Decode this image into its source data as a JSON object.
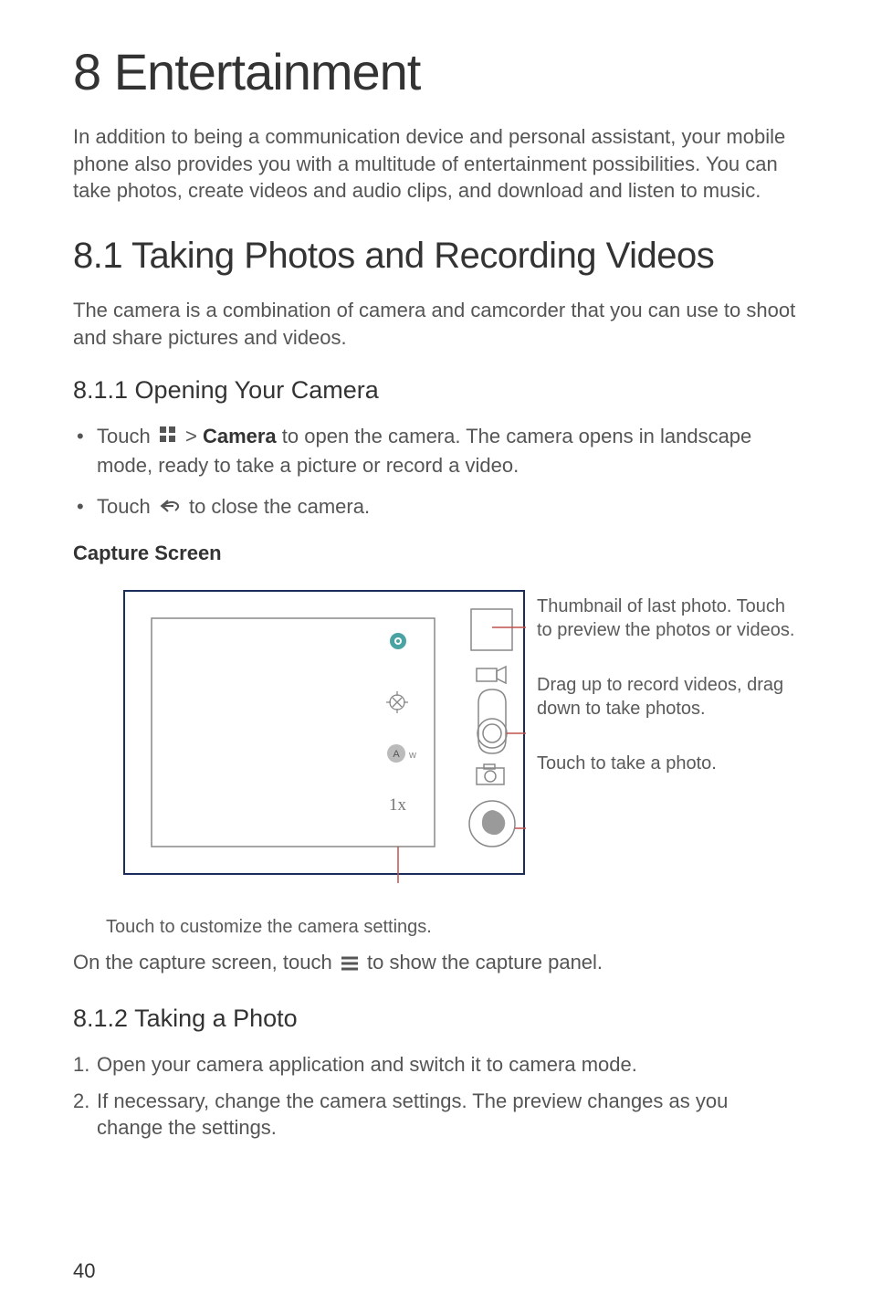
{
  "h1": "8  Entertainment",
  "intro": "In addition to being a communication device and personal assistant, your mobile phone also provides you with a multitude of entertainment possibilities. You can take photos, create videos and audio clips, and download and listen to music.",
  "h2": "8.1  Taking Photos and Recording Videos",
  "p2": "The camera is a combination of camera and camcorder that you can use to shoot and share pictures and videos.",
  "h3_1": "8.1.1  Opening Your Camera",
  "bullets": {
    "b1_a": "Touch",
    "b1_b": ">",
    "b1_bold": "Camera",
    "b1_c": "to open the camera. The camera opens in landscape mode, ready to take a picture or record a video.",
    "b2_a": "Touch",
    "b2_b": "to close the camera."
  },
  "subhead": "Capture Screen",
  "callouts": {
    "c1": "Thumbnail of last photo. Touch to preview the photos or videos.",
    "c2": "Drag up to record videos, drag down to take photos.",
    "c3": "Touch to take a photo."
  },
  "settings_caption": "Touch to customize the camera settings.",
  "body_line_a": "On the capture screen, touch",
  "body_line_b": "to show the capture panel.",
  "h3_2": "8.1.2  Taking a Photo",
  "ol": {
    "i1": "Open your camera application and switch it to camera mode.",
    "i2": "If necessary, change the camera settings. The preview changes as you change the settings."
  },
  "pagenum": "40",
  "diagram_labels": {
    "zoom": "1x",
    "aw": "A"
  }
}
